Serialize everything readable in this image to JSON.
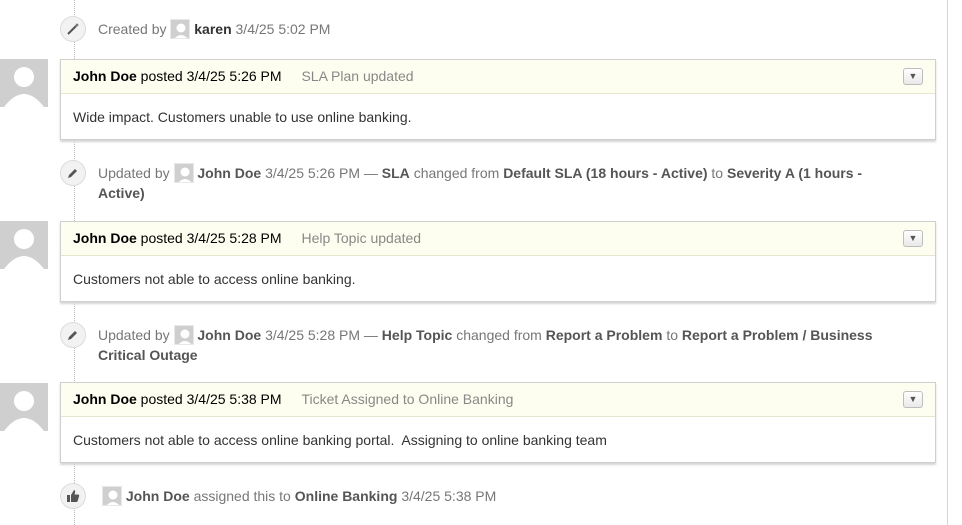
{
  "timeline": {
    "created": {
      "prefix": "Created by",
      "user": "karen",
      "time": "3/4/25 5:02 PM"
    },
    "threads": [
      {
        "author": "John Doe",
        "verb": "posted",
        "time": "3/4/25 5:26 PM",
        "title": "SLA Plan updated",
        "body": "Wide impact. Customers unable to use online banking."
      },
      {
        "author": "John Doe",
        "verb": "posted",
        "time": "3/4/25 5:28 PM",
        "title": "Help Topic updated",
        "body": "Customers not able to access online banking."
      },
      {
        "author": "John Doe",
        "verb": "posted",
        "time": "3/4/25 5:38 PM",
        "title": "Ticket Assigned to Online Banking",
        "body": "Customers not able to access online banking portal.  Assigning to online banking team"
      }
    ],
    "updates": [
      {
        "prefix": "Updated by",
        "user": "John Doe",
        "time": "3/4/25 5:26 PM",
        "dash": "—",
        "field": "SLA",
        "changed_from": "changed from",
        "from": "Default SLA (18 hours - Active)",
        "to_word": "to",
        "to": "Severity A (1 hours - Active)"
      },
      {
        "prefix": "Updated by",
        "user": "John Doe",
        "time": "3/4/25 5:28 PM",
        "dash": "—",
        "field": "Help Topic",
        "changed_from": "changed from",
        "from": "Report a Problem",
        "to_word": "to",
        "to": "Report a Problem / Business Critical Outage"
      }
    ],
    "assigned": {
      "user": "John Doe",
      "text": "assigned this to",
      "team": "Online Banking",
      "time": "3/4/25 5:38 PM"
    }
  },
  "icons": {
    "created": "magic-wand-icon",
    "updated": "pencil-icon",
    "assigned": "thumbs-up-icon",
    "menu": "caret-down-icon",
    "avatar": "default-user-avatar"
  }
}
